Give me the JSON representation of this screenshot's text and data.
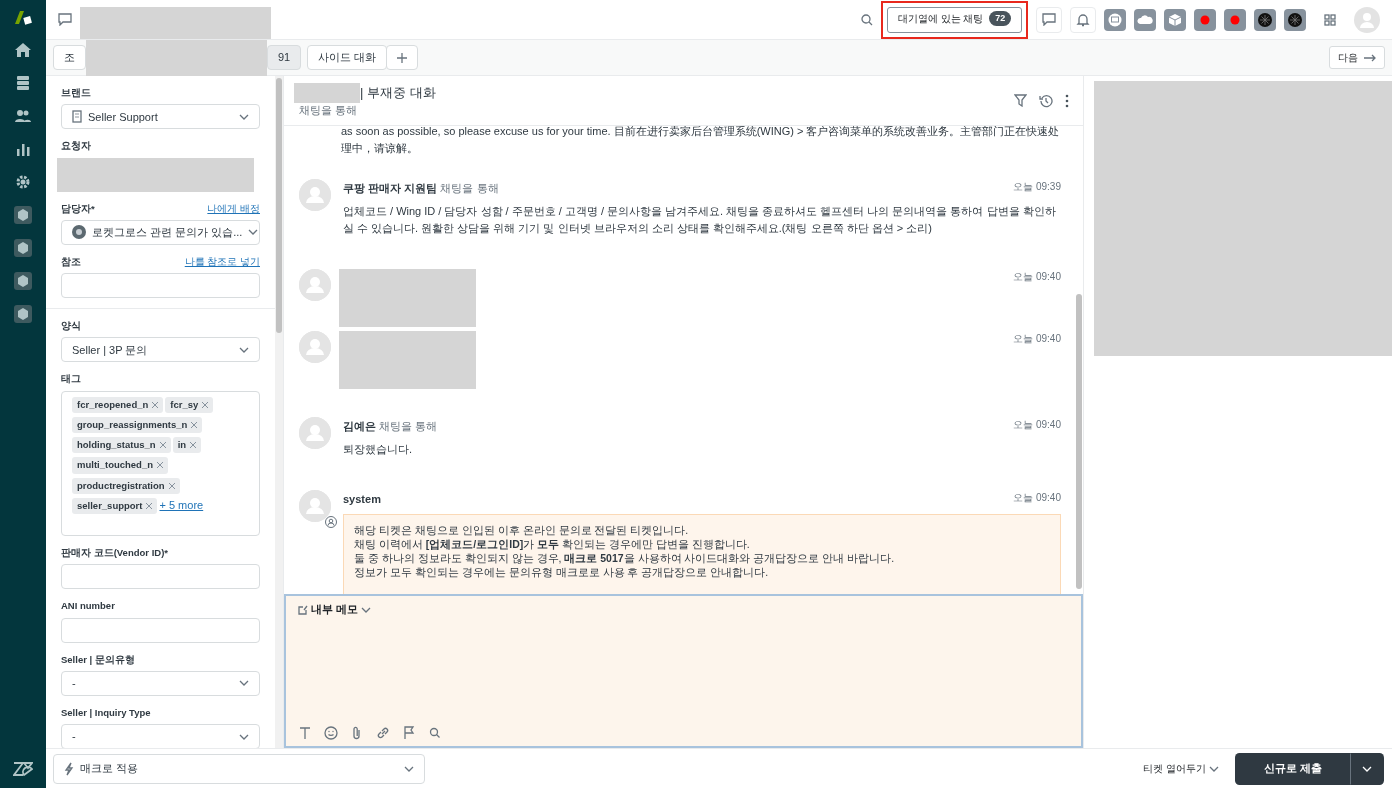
{
  "header": {
    "queue_button": "대기열에 있는 채팅",
    "queue_count": "72",
    "highlighted": true,
    "apps": [
      {
        "kind": "screen"
      },
      {
        "kind": "cloud"
      },
      {
        "kind": "cube"
      },
      {
        "kind": "dot"
      },
      {
        "kind": "dot"
      },
      {
        "kind": "wheel"
      },
      {
        "kind": "wheel"
      }
    ]
  },
  "tabs": [
    {
      "label": "조",
      "selected": false
    },
    {
      "label": "91",
      "selected": true
    },
    {
      "label": "사이드 대화",
      "selected": false
    }
  ],
  "next_button": "다음",
  "form_groups": [
    [
      {
        "kind": "select_icon",
        "label": "브랜드",
        "value": "Seller Support"
      },
      {
        "kind": "redacted",
        "label": "요청자"
      },
      {
        "kind": "select_avatar",
        "label": "담당자*",
        "action": "나에게 배정",
        "value": "로켓그로스 관련 문의가 있습..."
      },
      {
        "kind": "input",
        "label": "참조",
        "action": "나를 참조로 넣기"
      }
    ],
    [
      {
        "kind": "select",
        "label": "양식",
        "value": "Seller | 3P 문의"
      },
      {
        "kind": "tags",
        "label": "태그",
        "tags": [
          "fcr_reopened_n",
          "fcr_sy",
          "group_reassignments_n",
          "holding_status_n",
          "in",
          "multi_touched_n",
          "productregistration",
          "seller_support"
        ],
        "more": "+ 5 more"
      },
      {
        "kind": "input",
        "label": "판매자 코드(Vendor ID)*"
      },
      {
        "kind": "input",
        "label": "ANI number"
      },
      {
        "kind": "select",
        "label": "Seller | 문의유형",
        "value": "-"
      },
      {
        "kind": "select",
        "label": "Seller | Inquiry Type",
        "value": "-"
      }
    ]
  ],
  "conversation": {
    "title": "| 부재중 대화",
    "subtitle": "채팅을 통해",
    "messages": [
      {
        "kind": "continued",
        "text": "as soon as possible, so please excuse us for your time.  目前在进行卖家后台管理系统(WING) > 客户咨询菜单的系统改善业务。主管部门正在快速处理中，请谅解。"
      },
      {
        "kind": "text",
        "author": "쿠팡 판매자 지원팀",
        "via": "채팅을 통해",
        "time": "오늘 09:39",
        "text": "업체코드 / Wing ID / 담당자 성함 / 주문번호 / 고객명 / 문의사항을 남겨주세요. 채팅을 종료하셔도 헬프센터 나의 문의내역을 통하여 답변을 확인하실 수 있습니다. 원활한 상담을 위해 기기 및 인터넷 브라우저의 소리 상태를 확인해주세요.(채팅 오른쪽 하단 옵션 > 소리)"
      },
      {
        "kind": "image",
        "time": "오늘 09:40"
      },
      {
        "kind": "image",
        "time": "오늘 09:40"
      },
      {
        "kind": "text",
        "author": "김예은",
        "via": "채팅을 통해",
        "time": "오늘 09:40",
        "text": "퇴장했습니다."
      },
      {
        "kind": "system",
        "author": "system",
        "time": "오늘 09:40",
        "lines": [
          "해당 티켓은 채팅으로 인입된 이후 온라인 문의로 전달된 티켓입니다.",
          "채팅 이력에서 **[업체코드/로그인ID]**가 **모두** 확인되는 경우에만 답변을 진행합니다.",
          "둘 중 하나의 정보라도 확인되지 않는 경우, **매크로 5017**을 사용하여 사이드대화와 공개답장으로 안내 바랍니다.",
          "정보가 모두 확인되는 경우에는 문의유형 매크로로 사용 후 공개답장으로 안내합니다."
        ]
      }
    ]
  },
  "composer": {
    "mode": "내부 메모"
  },
  "footer": {
    "macro": "매크로 적용",
    "status": "티켓 열어두기",
    "submit": "신규로 제출"
  }
}
